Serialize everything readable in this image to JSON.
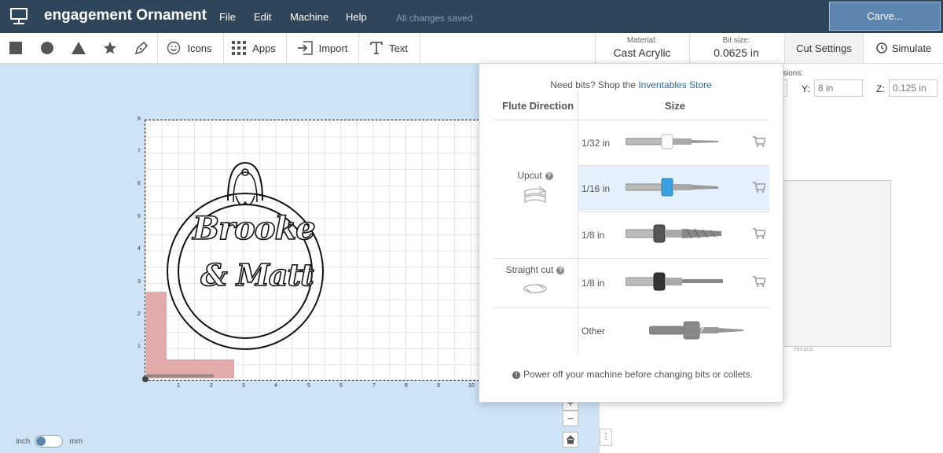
{
  "header": {
    "project_title": "engagement Ornament",
    "menu": [
      "File",
      "Edit",
      "Machine",
      "Help"
    ],
    "save_status": "All changes saved",
    "carve_label": "Carve..."
  },
  "toolbar": {
    "shapes": [
      "square",
      "circle",
      "triangle",
      "star",
      "pen"
    ],
    "icons_label": "Icons",
    "apps_label": "Apps",
    "import_label": "Import",
    "text_label": "Text",
    "material_caption": "Material:",
    "material_value": "Cast Acrylic",
    "bit_caption": "Bit size:",
    "bit_value": "0.0625 in",
    "cut_settings_label": "Cut Settings",
    "simulate_label": "Simulate"
  },
  "canvas": {
    "x_ticks": [
      "1",
      "2",
      "3",
      "4",
      "5",
      "6",
      "7",
      "8",
      "9",
      "10"
    ],
    "y_ticks": [
      "8",
      "7",
      "6",
      "5",
      "4",
      "3",
      "2",
      "1"
    ],
    "design_text_line1": "Brooke",
    "design_text_line2": "& Matt",
    "zoom_in": "+",
    "zoom_out": "−",
    "home_icon": "home-icon",
    "unit_left": "inch",
    "unit_right": "mm"
  },
  "dimensions": {
    "caption": "sions:",
    "y_label": "Y:",
    "y_value": "8 in",
    "z_label": "Z:",
    "z_value": "0.125 in",
    "preview_ticks": "7  8  9  10  11"
  },
  "bit_popover": {
    "head_text": "Need bits? Shop the ",
    "head_link": "Inventables Store",
    "col_flute": "Flute Direction",
    "col_size": "Size",
    "flute_groups": [
      {
        "name": "Upcut",
        "help": "?"
      },
      {
        "name": "Straight cut",
        "help": "?"
      }
    ],
    "bits": [
      {
        "size": "1/32 in",
        "collar": "#ffffff",
        "selected": false
      },
      {
        "size": "1/16 in",
        "collar": "#3aa0e0",
        "selected": true
      },
      {
        "size": "1/8 in",
        "collar": "#555555",
        "selected": false
      },
      {
        "size": "1/8 in",
        "collar": "#333333",
        "selected": false
      },
      {
        "size": "Other",
        "collar": "#888888",
        "selected": false
      }
    ],
    "other_help": "?",
    "footer": "Power off your machine before changing bits or collets."
  },
  "colors": {
    "nav_bg": "#2f4559",
    "carve_bg": "#5c86b0",
    "canvas_bg": "#cfe3f7",
    "selected_row": "#e4f0fc",
    "link": "#2f6a96",
    "clamp": "#e2aaaa"
  }
}
